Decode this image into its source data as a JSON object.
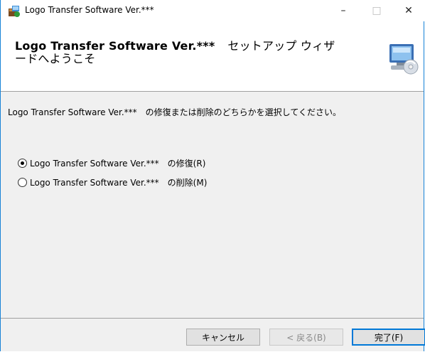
{
  "window": {
    "title": "Logo Transfer Software Ver.***",
    "minimize_label": "–",
    "maximize_label": "□",
    "close_label": "✕",
    "icon": "installer-icon"
  },
  "header": {
    "title_bold": "Logo Transfer Software Ver.***",
    "title_rest_line1": "セットアップ ウィザ",
    "title_line2": "ードへようこそ",
    "icon": "computer-cd-icon"
  },
  "main": {
    "instruction": "Logo Transfer Software Ver.***　の修復または削除のどちらかを選択してください。",
    "options": [
      {
        "label": "Logo Transfer Software Ver.***　の修復(R)",
        "selected": true
      },
      {
        "label": "Logo Transfer Software Ver.***　の削除(M)",
        "selected": false
      }
    ]
  },
  "footer": {
    "cancel_label": "キャンセル",
    "back_label": "< 戻る(B)",
    "finish_label": "完了(F)"
  }
}
